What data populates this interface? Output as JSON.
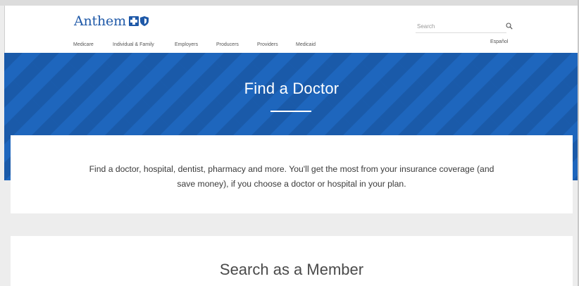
{
  "header": {
    "logo_text": "Anthem",
    "search": {
      "placeholder": "Search"
    },
    "language_link": "Español",
    "nav": [
      {
        "label": "Medicare"
      },
      {
        "label": "Individual & Family"
      },
      {
        "label": "Employers"
      },
      {
        "label": "Producers"
      },
      {
        "label": "Providers"
      },
      {
        "label": "Medicaid"
      }
    ]
  },
  "hero": {
    "title": "Find a Doctor"
  },
  "intro": {
    "line1": "Find a doctor, hospital, dentist, pharmacy and more. You'll get the most from your insurance coverage (and",
    "line2": "save money), if you choose a doctor or hospital in your plan."
  },
  "member_section": {
    "title": "Search as a Member"
  },
  "colors": {
    "brand_blue": "#1e66bd",
    "logo_blue": "#1f59a8",
    "background_gray": "#ededed"
  },
  "icons": {
    "search": "search-icon",
    "logo_cross": "blue-cross-icon",
    "logo_shield": "blue-shield-icon"
  }
}
